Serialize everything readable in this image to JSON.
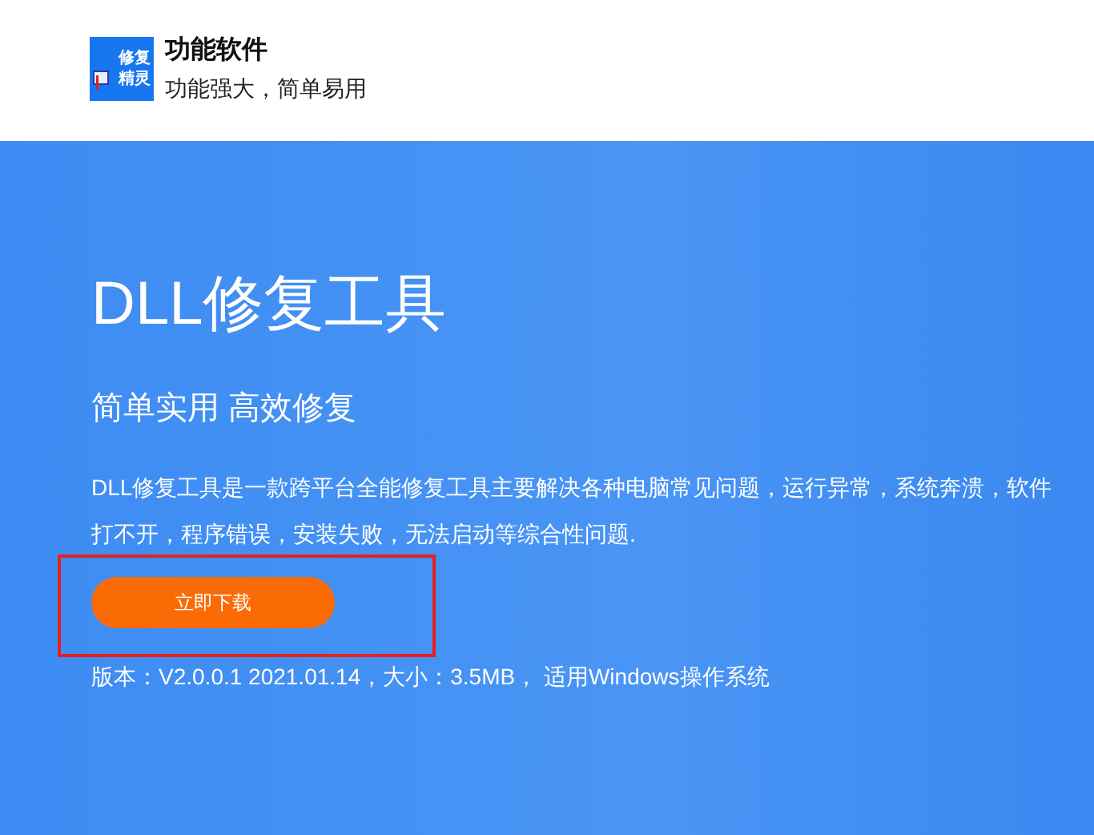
{
  "header": {
    "logo_text": [
      "修复",
      "精灵"
    ],
    "title": "功能软件",
    "tagline": "功能强大，简单易用"
  },
  "banner": {
    "heading": "DLL修复工具",
    "subtitle": "简单实用 高效修复",
    "description": "DLL修复工具是一款跨平台全能修复工具主要解决各种电脑常见问题，运行异常，系统奔溃，软件打不开，程序错误，安装失败，无法启动等综合性问题.",
    "download_button": "立即下载",
    "version_info": "版本：V2.0.0.1 2021.01.14，大小：3.5MB， 适用Windows操作系统"
  }
}
